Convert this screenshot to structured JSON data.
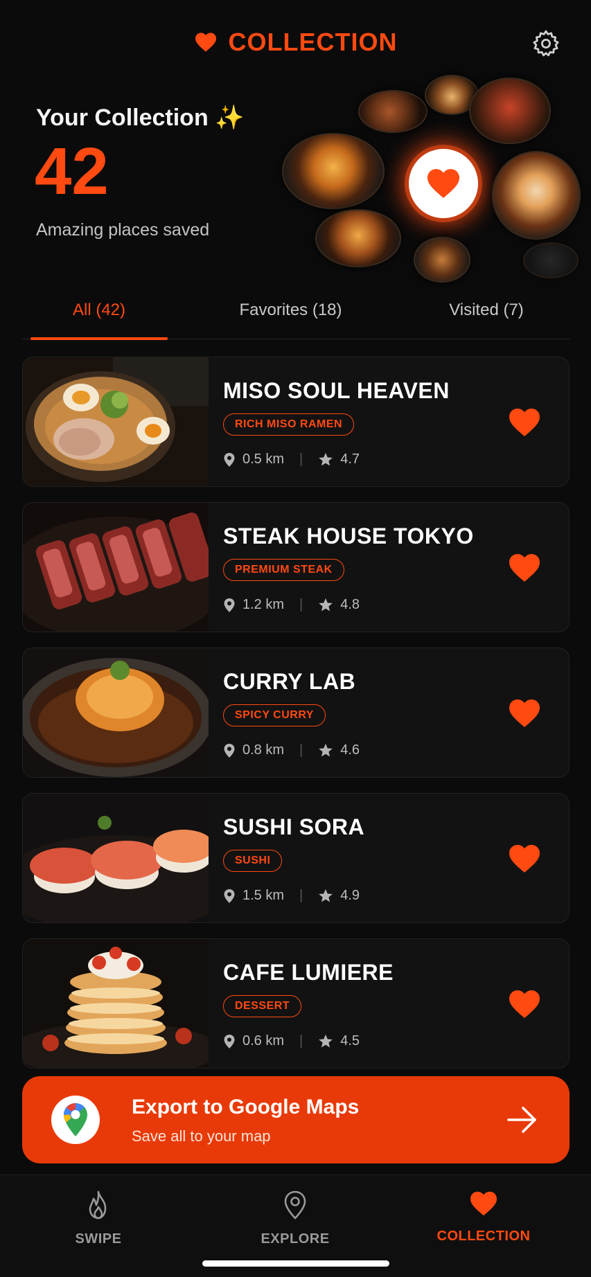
{
  "header": {
    "title": "COLLECTION",
    "accent": "#ff4a12"
  },
  "hero": {
    "heading": "Your Collection ✨",
    "count": "42",
    "subtitle": "Amazing places saved"
  },
  "tabs": [
    {
      "label": "All (42)",
      "active": true
    },
    {
      "label": "Favorites (18)",
      "active": false
    },
    {
      "label": "Visited (7)",
      "active": false
    }
  ],
  "places": [
    {
      "name": "MISO SOUL HEAVEN",
      "tag": "RICH MISO RAMEN",
      "distance": "0.5 km",
      "rating": "4.7",
      "image": "ramen"
    },
    {
      "name": "STEAK HOUSE TOKYO",
      "tag": "PREMIUM STEAK",
      "distance": "1.2 km",
      "rating": "4.8",
      "image": "steak"
    },
    {
      "name": "CURRY LAB",
      "tag": "SPICY CURRY",
      "distance": "0.8 km",
      "rating": "4.6",
      "image": "curry"
    },
    {
      "name": "SUSHI SORA",
      "tag": "SUSHI",
      "distance": "1.5 km",
      "rating": "4.9",
      "image": "sushi"
    },
    {
      "name": "CAFE LUMIERE",
      "tag": "DESSERT",
      "distance": "0.6 km",
      "rating": "4.5",
      "image": "pancakes"
    }
  ],
  "export": {
    "title": "Export to Google Maps",
    "subtitle": "Save all to your map"
  },
  "nav": [
    {
      "label": "SWIPE",
      "icon": "flame-icon",
      "active": false
    },
    {
      "label": "EXPLORE",
      "icon": "map-pin-icon",
      "active": false
    },
    {
      "label": "COLLECTION",
      "icon": "heart-icon",
      "active": true
    }
  ]
}
